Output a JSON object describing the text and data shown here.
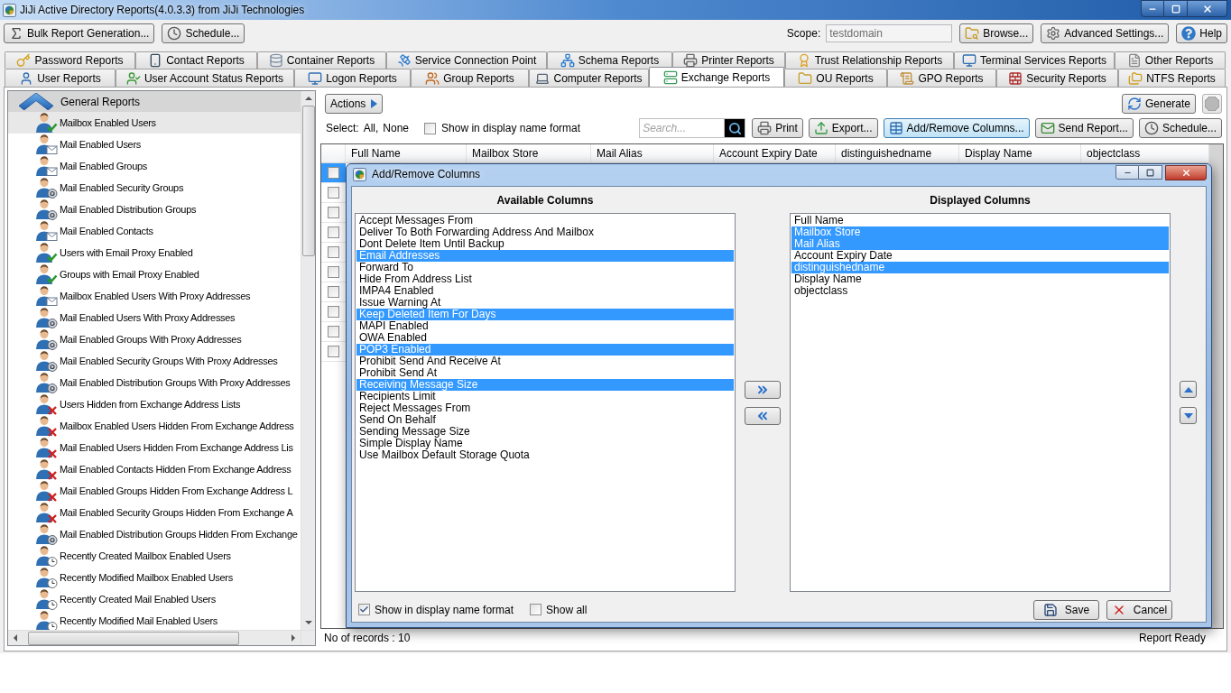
{
  "window": {
    "title": "JiJi Active Directory Reports(4.0.3.3) from JiJi Technologies"
  },
  "toolbar": {
    "left_buttons": [
      "Bulk Report Generation...",
      "Schedule..."
    ],
    "scope": {
      "label": "Scope:",
      "value": "testdomain",
      "disabled": true
    },
    "right_buttons": [
      "Browse...",
      "Advanced Settings...",
      "Help"
    ]
  },
  "tabs": {
    "upper_row": [
      {
        "label": "Password Reports",
        "selected": false
      },
      {
        "label": "Contact Reports",
        "selected": false
      },
      {
        "label": "Container Reports",
        "selected": false
      },
      {
        "label": "Service Connection Point",
        "selected": false
      },
      {
        "label": "Schema Reports",
        "selected": false
      },
      {
        "label": "Printer Reports",
        "selected": false
      },
      {
        "label": "Trust Relationship Reports",
        "selected": false
      },
      {
        "label": "Terminal Services Reports",
        "selected": false
      },
      {
        "label": "Other Reports",
        "selected": false
      }
    ],
    "lower_row": [
      {
        "label": "User Reports",
        "selected": false
      },
      {
        "label": "User Account Status Reports",
        "selected": false
      },
      {
        "label": "Logon Reports",
        "selected": false
      },
      {
        "label": "Group Reports",
        "selected": false
      },
      {
        "label": "Computer Reports",
        "selected": false
      },
      {
        "label": "Exchange Reports",
        "selected": true
      },
      {
        "label": "OU Reports",
        "selected": false
      },
      {
        "label": "GPO Reports",
        "selected": false
      },
      {
        "label": "Security Reports",
        "selected": false
      },
      {
        "label": "NTFS Reports",
        "selected": false
      }
    ]
  },
  "sidebar": {
    "group": {
      "title": "General Reports",
      "expanded": true
    },
    "items": [
      {
        "label": "Mailbox Enabled Users",
        "selected": true
      },
      {
        "label": "Mail Enabled Users",
        "selected": false
      },
      {
        "label": "Mail Enabled Groups",
        "selected": false
      },
      {
        "label": "Mail Enabled Security Groups",
        "selected": false
      },
      {
        "label": "Mail Enabled Distribution Groups",
        "selected": false
      },
      {
        "label": "Mail Enabled Contacts",
        "selected": false
      },
      {
        "label": "Users with Email Proxy Enabled",
        "selected": false
      },
      {
        "label": "Groups with Email Proxy Enabled",
        "selected": false
      },
      {
        "label": "Mailbox Enabled Users With Proxy Addresses",
        "selected": false
      },
      {
        "label": "Mail Enabled Users With Proxy Addresses",
        "selected": false
      },
      {
        "label": "Mail Enabled Groups With Proxy Addresses",
        "selected": false
      },
      {
        "label": "Mail Enabled Security Groups With Proxy Addresses",
        "selected": false
      },
      {
        "label": "Mail Enabled Distribution Groups With Proxy Addresses",
        "selected": false
      },
      {
        "label": "Users Hidden from Exchange Address Lists",
        "selected": false
      },
      {
        "label": "Mailbox Enabled Users Hidden From Exchange Address",
        "selected": false
      },
      {
        "label": "Mail Enabled Users Hidden From Exchange Address Lis",
        "selected": false
      },
      {
        "label": "Mail Enabled Contacts Hidden From Exchange Address",
        "selected": false
      },
      {
        "label": "Mail Enabled Groups Hidden From Exchange Address L",
        "selected": false
      },
      {
        "label": "Mail Enabled Security Groups Hidden From Exchange A",
        "selected": false
      },
      {
        "label": "Mail Enabled Distribution Groups Hidden From Exchange",
        "selected": false
      },
      {
        "label": "Recently Created Mailbox Enabled Users",
        "selected": false
      },
      {
        "label": "Recently Modified Mailbox Enabled Users",
        "selected": false
      },
      {
        "label": "Recently Created Mail Enabled Users",
        "selected": false
      },
      {
        "label": "Recently Modified Mail Enabled Users",
        "selected": false
      }
    ]
  },
  "report": {
    "actions_button": "Actions",
    "generate_button": "Generate",
    "select": {
      "label": "Select:",
      "options": [
        "All,",
        "None"
      ]
    },
    "display_name_format": {
      "label": "Show in display name format",
      "checked": false
    },
    "search": {
      "placeholder": "Search..."
    },
    "buttons": [
      {
        "label": "Print",
        "selected": false
      },
      {
        "label": "Export...",
        "selected": false
      },
      {
        "label": "Add/Remove Columns...",
        "selected": true
      },
      {
        "label": "Send Report...",
        "selected": false
      },
      {
        "label": "Schedule...",
        "selected": false
      }
    ],
    "table": {
      "columns": [
        "Full Name",
        "Mailbox Store",
        "Mail Alias",
        "Account Expiry Date",
        "distinguishedname",
        "Display Name",
        "objectclass"
      ],
      "rows": [
        {
          "selected": true,
          "checked": false
        },
        {
          "selected": false,
          "checked": false
        },
        {
          "selected": false,
          "checked": false
        },
        {
          "selected": false,
          "checked": false
        },
        {
          "selected": false,
          "checked": false
        },
        {
          "selected": false,
          "checked": false
        },
        {
          "selected": false,
          "checked": false
        },
        {
          "selected": false,
          "checked": false
        },
        {
          "selected": false,
          "checked": false
        },
        {
          "selected": false,
          "checked": false
        }
      ]
    },
    "status_bar": {
      "records": "No of records : 10",
      "status": "Report Ready"
    }
  },
  "dialog": {
    "title": "Add/Remove Columns",
    "available": {
      "title": "Available Columns",
      "items": [
        {
          "label": "Accept Messages From",
          "selected": false
        },
        {
          "label": "Deliver To Both Forwarding Address And Mailbox",
          "selected": false
        },
        {
          "label": "Dont Delete Item Until Backup",
          "selected": false
        },
        {
          "label": "Email Addresses",
          "selected": true
        },
        {
          "label": "Forward To",
          "selected": false
        },
        {
          "label": "Hide From Address List",
          "selected": false
        },
        {
          "label": "IMPA4 Enabled",
          "selected": false
        },
        {
          "label": "Issue Warning At",
          "selected": false
        },
        {
          "label": "Keep Deleted Item For Days",
          "selected": true
        },
        {
          "label": "MAPI Enabled",
          "selected": false
        },
        {
          "label": "OWA Enabled",
          "selected": false
        },
        {
          "label": "POP3 Enabled",
          "selected": true
        },
        {
          "label": "Prohibit Send And Receive At",
          "selected": false
        },
        {
          "label": "Prohibit Send At",
          "selected": false
        },
        {
          "label": "Receiving Message Size",
          "selected": true
        },
        {
          "label": "Recipients Limit",
          "selected": false
        },
        {
          "label": "Reject Messages From",
          "selected": false
        },
        {
          "label": "Send On Behalf",
          "selected": false
        },
        {
          "label": "Sending Message Size",
          "selected": false
        },
        {
          "label": "Simple Display Name",
          "selected": false
        },
        {
          "label": "Use Mailbox Default Storage Quota",
          "selected": false
        }
      ]
    },
    "displayed": {
      "title": "Displayed Columns",
      "items": [
        {
          "label": "Full Name",
          "selected": false
        },
        {
          "label": "Mailbox Store",
          "selected": true
        },
        {
          "label": "Mail Alias",
          "selected": true
        },
        {
          "label": "Account Expiry Date",
          "selected": false
        },
        {
          "label": "distinguishedname",
          "selected": true
        },
        {
          "label": "Display Name",
          "selected": false
        },
        {
          "label": "objectclass",
          "selected": false
        }
      ]
    },
    "options": [
      {
        "label": "Show in display name format",
        "checked": true
      },
      {
        "label": "Show all",
        "checked": false
      }
    ],
    "buttons": [
      "Save",
      "Cancel"
    ]
  }
}
